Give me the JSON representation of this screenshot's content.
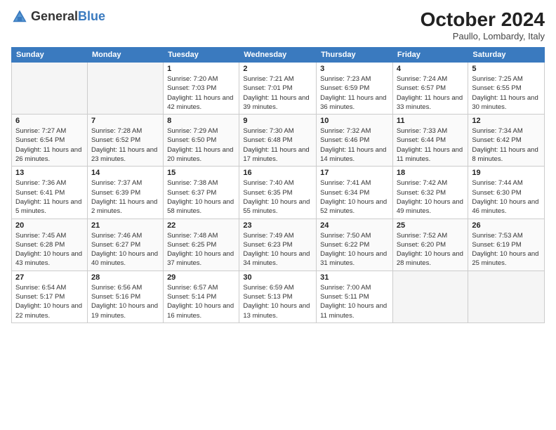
{
  "header": {
    "logo_general": "General",
    "logo_blue": "Blue",
    "month": "October 2024",
    "location": "Paullo, Lombardy, Italy"
  },
  "columns": [
    "Sunday",
    "Monday",
    "Tuesday",
    "Wednesday",
    "Thursday",
    "Friday",
    "Saturday"
  ],
  "weeks": [
    [
      {
        "day": "",
        "info": ""
      },
      {
        "day": "",
        "info": ""
      },
      {
        "day": "1",
        "info": "Sunrise: 7:20 AM\nSunset: 7:03 PM\nDaylight: 11 hours and 42 minutes."
      },
      {
        "day": "2",
        "info": "Sunrise: 7:21 AM\nSunset: 7:01 PM\nDaylight: 11 hours and 39 minutes."
      },
      {
        "day": "3",
        "info": "Sunrise: 7:23 AM\nSunset: 6:59 PM\nDaylight: 11 hours and 36 minutes."
      },
      {
        "day": "4",
        "info": "Sunrise: 7:24 AM\nSunset: 6:57 PM\nDaylight: 11 hours and 33 minutes."
      },
      {
        "day": "5",
        "info": "Sunrise: 7:25 AM\nSunset: 6:55 PM\nDaylight: 11 hours and 30 minutes."
      }
    ],
    [
      {
        "day": "6",
        "info": "Sunrise: 7:27 AM\nSunset: 6:54 PM\nDaylight: 11 hours and 26 minutes."
      },
      {
        "day": "7",
        "info": "Sunrise: 7:28 AM\nSunset: 6:52 PM\nDaylight: 11 hours and 23 minutes."
      },
      {
        "day": "8",
        "info": "Sunrise: 7:29 AM\nSunset: 6:50 PM\nDaylight: 11 hours and 20 minutes."
      },
      {
        "day": "9",
        "info": "Sunrise: 7:30 AM\nSunset: 6:48 PM\nDaylight: 11 hours and 17 minutes."
      },
      {
        "day": "10",
        "info": "Sunrise: 7:32 AM\nSunset: 6:46 PM\nDaylight: 11 hours and 14 minutes."
      },
      {
        "day": "11",
        "info": "Sunrise: 7:33 AM\nSunset: 6:44 PM\nDaylight: 11 hours and 11 minutes."
      },
      {
        "day": "12",
        "info": "Sunrise: 7:34 AM\nSunset: 6:42 PM\nDaylight: 11 hours and 8 minutes."
      }
    ],
    [
      {
        "day": "13",
        "info": "Sunrise: 7:36 AM\nSunset: 6:41 PM\nDaylight: 11 hours and 5 minutes."
      },
      {
        "day": "14",
        "info": "Sunrise: 7:37 AM\nSunset: 6:39 PM\nDaylight: 11 hours and 2 minutes."
      },
      {
        "day": "15",
        "info": "Sunrise: 7:38 AM\nSunset: 6:37 PM\nDaylight: 10 hours and 58 minutes."
      },
      {
        "day": "16",
        "info": "Sunrise: 7:40 AM\nSunset: 6:35 PM\nDaylight: 10 hours and 55 minutes."
      },
      {
        "day": "17",
        "info": "Sunrise: 7:41 AM\nSunset: 6:34 PM\nDaylight: 10 hours and 52 minutes."
      },
      {
        "day": "18",
        "info": "Sunrise: 7:42 AM\nSunset: 6:32 PM\nDaylight: 10 hours and 49 minutes."
      },
      {
        "day": "19",
        "info": "Sunrise: 7:44 AM\nSunset: 6:30 PM\nDaylight: 10 hours and 46 minutes."
      }
    ],
    [
      {
        "day": "20",
        "info": "Sunrise: 7:45 AM\nSunset: 6:28 PM\nDaylight: 10 hours and 43 minutes."
      },
      {
        "day": "21",
        "info": "Sunrise: 7:46 AM\nSunset: 6:27 PM\nDaylight: 10 hours and 40 minutes."
      },
      {
        "day": "22",
        "info": "Sunrise: 7:48 AM\nSunset: 6:25 PM\nDaylight: 10 hours and 37 minutes."
      },
      {
        "day": "23",
        "info": "Sunrise: 7:49 AM\nSunset: 6:23 PM\nDaylight: 10 hours and 34 minutes."
      },
      {
        "day": "24",
        "info": "Sunrise: 7:50 AM\nSunset: 6:22 PM\nDaylight: 10 hours and 31 minutes."
      },
      {
        "day": "25",
        "info": "Sunrise: 7:52 AM\nSunset: 6:20 PM\nDaylight: 10 hours and 28 minutes."
      },
      {
        "day": "26",
        "info": "Sunrise: 7:53 AM\nSunset: 6:19 PM\nDaylight: 10 hours and 25 minutes."
      }
    ],
    [
      {
        "day": "27",
        "info": "Sunrise: 6:54 AM\nSunset: 5:17 PM\nDaylight: 10 hours and 22 minutes."
      },
      {
        "day": "28",
        "info": "Sunrise: 6:56 AM\nSunset: 5:16 PM\nDaylight: 10 hours and 19 minutes."
      },
      {
        "day": "29",
        "info": "Sunrise: 6:57 AM\nSunset: 5:14 PM\nDaylight: 10 hours and 16 minutes."
      },
      {
        "day": "30",
        "info": "Sunrise: 6:59 AM\nSunset: 5:13 PM\nDaylight: 10 hours and 13 minutes."
      },
      {
        "day": "31",
        "info": "Sunrise: 7:00 AM\nSunset: 5:11 PM\nDaylight: 10 hours and 11 minutes."
      },
      {
        "day": "",
        "info": ""
      },
      {
        "day": "",
        "info": ""
      }
    ]
  ]
}
